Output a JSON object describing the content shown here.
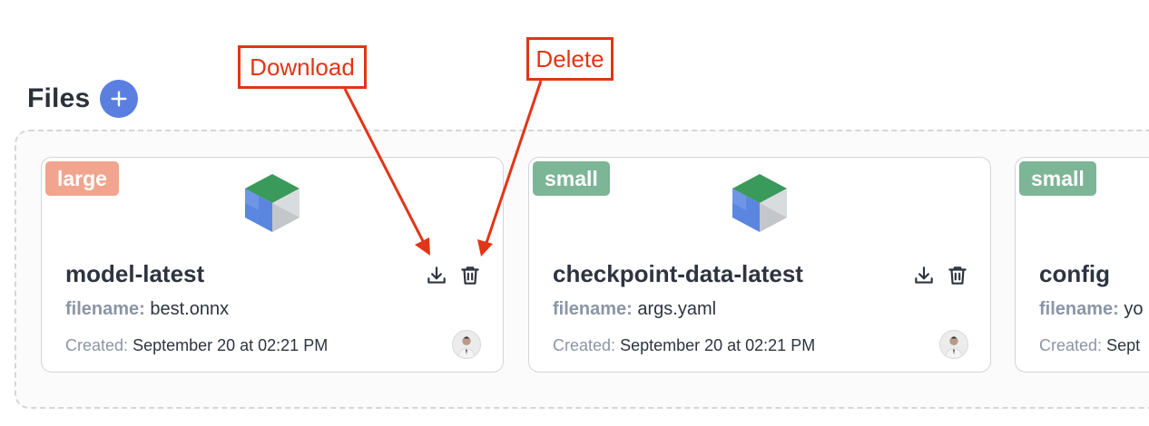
{
  "section": {
    "title": "Files",
    "add_icon": "plus-icon"
  },
  "annotations": {
    "download_label": "Download",
    "delete_label": "Delete",
    "color": "#e43417"
  },
  "colors": {
    "add_button": "#5a7fe0",
    "badge_large": "#f2a58e",
    "badge_small": "#7db597",
    "meta_key": "#8b95a5"
  },
  "labels": {
    "filename_key": "filename:",
    "created_key": "Created:"
  },
  "files": [
    {
      "size_badge": "large",
      "name": "model-latest",
      "filename": "best.onnx",
      "created": "September 20 at 02:21 PM",
      "icon": "model-cube-icon"
    },
    {
      "size_badge": "small",
      "name": "checkpoint-data-latest",
      "filename": "args.yaml",
      "created": "September 20 at 02:21 PM",
      "icon": "model-cube-icon"
    },
    {
      "size_badge": "small",
      "name": "config",
      "filename": "yo",
      "created": "Sept",
      "icon": "model-cube-icon"
    }
  ]
}
